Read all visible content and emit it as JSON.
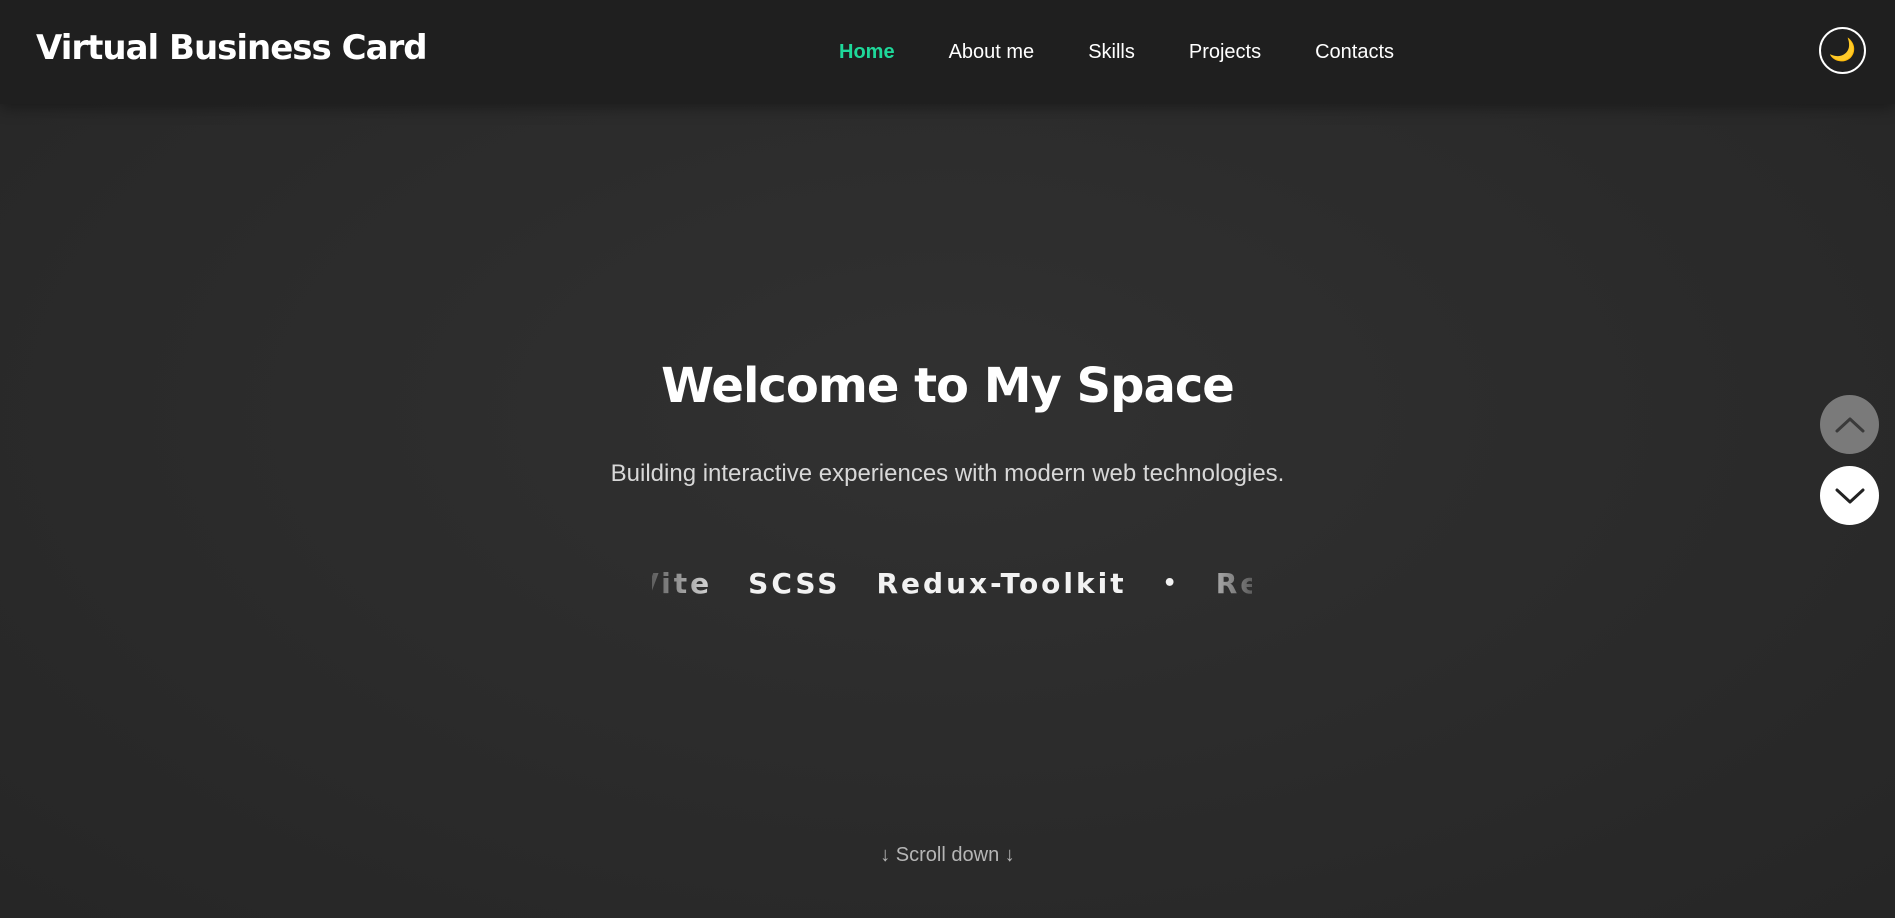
{
  "header": {
    "logo": "Virtual Business Card",
    "nav": [
      {
        "label": "Home",
        "active": true
      },
      {
        "label": "About me",
        "active": false
      },
      {
        "label": "Skills",
        "active": false
      },
      {
        "label": "Projects",
        "active": false
      },
      {
        "label": "Contacts",
        "active": false
      }
    ],
    "theme_toggle": {
      "icon": "moon-icon",
      "glyph": "🌙"
    }
  },
  "hero": {
    "title": "Welcome to My Space",
    "subtitle": "Building interactive experiences with modern web technologies.",
    "ticker": {
      "items": [
        "Vite",
        "SCSS",
        "Redux-Toolkit",
        "•",
        "React"
      ]
    },
    "scroll_hint": "↓ Scroll down ↓"
  },
  "side_nav": {
    "up_icon": "chevron-up-icon",
    "down_icon": "chevron-down-icon"
  },
  "colors": {
    "accent": "#1ed89a",
    "background": "#2a2a2a",
    "header_bg": "#1f1f1f"
  }
}
